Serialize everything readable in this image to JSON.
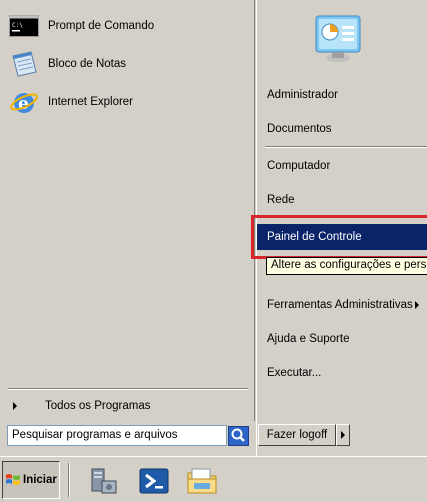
{
  "left_pane": {
    "programs": [
      {
        "label": "Prompt de Comando",
        "icon": "command-prompt-icon"
      },
      {
        "label": "Bloco de Notas",
        "icon": "notepad-icon"
      },
      {
        "label": "Internet Explorer",
        "icon": "internet-explorer-icon"
      }
    ],
    "all_programs_label": "Todos os Programas"
  },
  "right_pane": {
    "avatar_icon": "control-panel-user-icon",
    "items": [
      {
        "label": "Administrador"
      },
      {
        "label": "Documentos"
      },
      {
        "label": "Computador"
      },
      {
        "label": "Rede"
      },
      {
        "label": "Painel de Controle",
        "selected": true
      },
      {
        "label": "Ferramentas Administrativas",
        "submenu": true
      },
      {
        "label": "Ajuda e Suporte"
      },
      {
        "label": "Executar..."
      }
    ],
    "tooltip": "Altere as configurações e personalize"
  },
  "search": {
    "value": "Pesquisar programas e arquivos",
    "button_icon": "search-icon"
  },
  "logoff": {
    "label": "Fazer logoff",
    "arrow_icon": "chevron-right-icon"
  },
  "taskbar": {
    "start_label": "Iniciar",
    "quick_launch": [
      {
        "icon": "server-manager-icon"
      },
      {
        "icon": "powershell-icon"
      },
      {
        "icon": "windows-explorer-icon"
      }
    ]
  },
  "colors": {
    "selection": "#0a246a",
    "highlight_box": "#d9242c",
    "tooltip_bg": "#ffffe1"
  }
}
